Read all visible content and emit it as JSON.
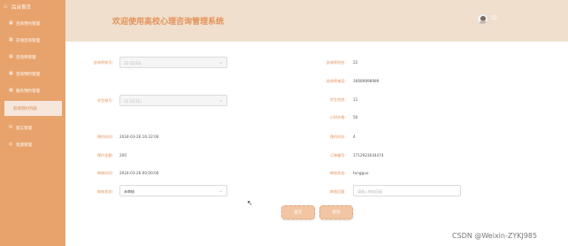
{
  "sidebar": {
    "brand_label": "后台首页",
    "items": [
      {
        "label": "咨询预约管理",
        "icon": "grid-icon"
      },
      {
        "label": "在线咨询管理",
        "icon": "grid-icon"
      },
      {
        "label": "咨询师管理",
        "icon": "grid-icon"
      },
      {
        "label": "咨询预约管理",
        "icon": "grid-icon"
      },
      {
        "label": "服务预约管理",
        "icon": "grid-icon"
      },
      {
        "label": "新闻预约列表",
        "icon": "grid-icon"
      },
      {
        "label": "留言管理",
        "icon": "message-icon"
      },
      {
        "label": "资源管理",
        "icon": "globe-icon"
      }
    ]
  },
  "header": {
    "title": "欢迎使用高校心理咨询管理系统",
    "username": "22"
  },
  "form": {
    "counselor_account_label": "咨询师账号:",
    "counselor_account_value": "22 (2233)",
    "counselor_name_label": "咨询师姓名:",
    "counselor_name_value": "22",
    "counselor_phone_label": "咨询师电话:",
    "counselor_phone_value": "16689898989",
    "student_account_label": "学生账号:",
    "student_account_value": "11 (1111)",
    "student_name_label": "学生姓名:",
    "student_name_value": "11",
    "price_label": "小时价格:",
    "price_value": "50",
    "booking_time_label": "预约时间:",
    "booking_time_value": "2024-03-26 16:32:00",
    "booking_hours_label": "预约时长:",
    "booking_hours_value": "4",
    "booking_amount_label": "预约金额:",
    "booking_amount_value": "200",
    "order_no_label": "订单编号:",
    "order_no_value": "1712923034474",
    "review_time_label": "审核时间:",
    "review_time_value": "2024-03-26 00:00:00",
    "review_status_label": "审核状态:",
    "review_status_value": "tongguo",
    "audit_status_label": "审核状态:",
    "audit_status_value": "未审核",
    "audit_reply_label": "审核回复:",
    "audit_reply_placeholder": "请输入审核回复"
  },
  "actions": {
    "submit_label": "提交",
    "cancel_label": "取消"
  },
  "watermark": "CSDN @Weixin-ZYKJ985",
  "colors": {
    "sidebar": "#e8a36c",
    "header": "#f1dfcd",
    "accent": "#e3935a"
  }
}
